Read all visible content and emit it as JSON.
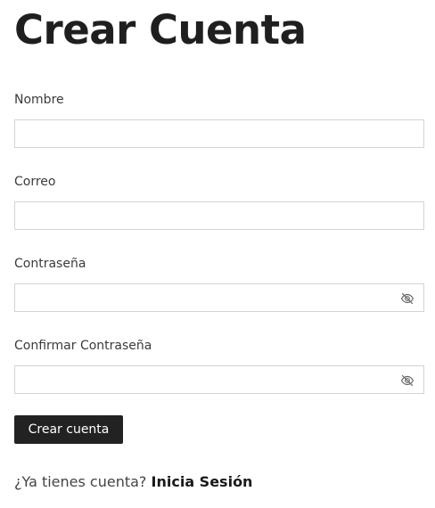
{
  "page": {
    "title": "Crear Cuenta"
  },
  "form": {
    "nombre": {
      "label": "Nombre",
      "value": "",
      "placeholder": ""
    },
    "correo": {
      "label": "Correo",
      "value": "",
      "placeholder": ""
    },
    "contrasena": {
      "label": "Contraseña",
      "value": "",
      "placeholder": "",
      "icon": "eye-slash-icon"
    },
    "confirmar": {
      "label": "Confirmar Contraseña",
      "value": "",
      "placeholder": "",
      "icon": "eye-slash-icon"
    },
    "submit_label": "Crear cuenta"
  },
  "footer": {
    "prompt": "¿Ya tienes cuenta?",
    "link_label": "Inicia Sesión"
  },
  "colors": {
    "button_bg": "#222222",
    "button_text": "#ffffff",
    "field_border": "#d3d3d3",
    "text": "#222222"
  }
}
